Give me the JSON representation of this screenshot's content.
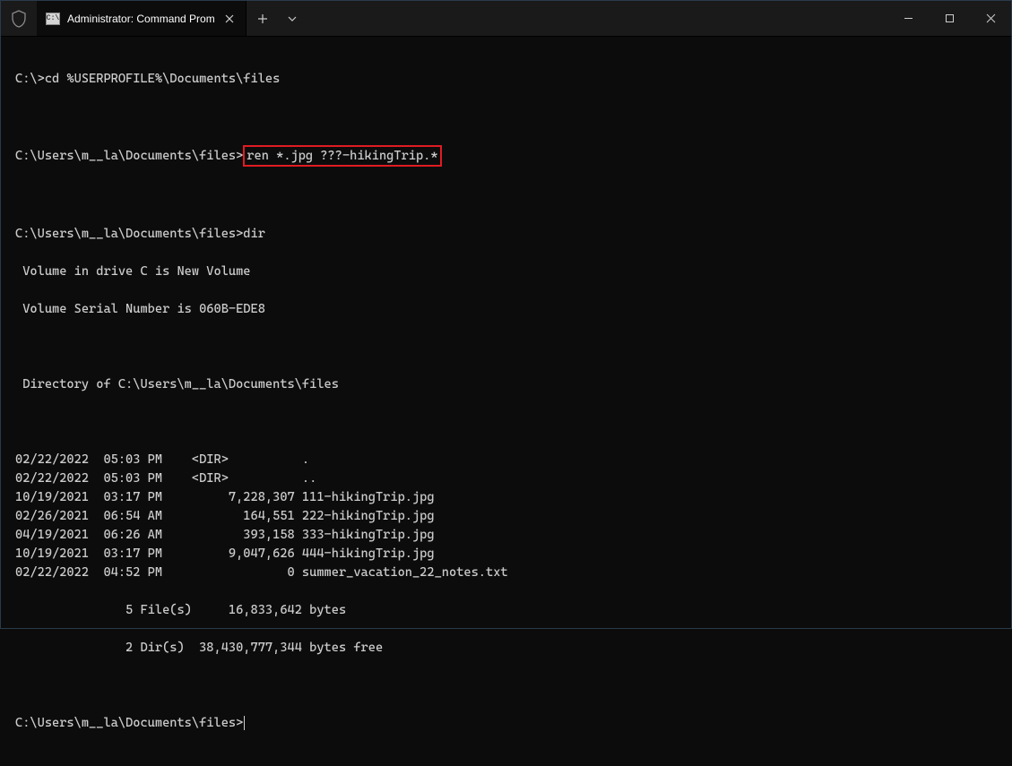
{
  "window": {
    "tab_title": "Administrator: Command Prom"
  },
  "terminal": {
    "line1_prompt": "C:\\>",
    "line1_cmd": "cd %USERPROFILE%\\Documents\\files",
    "line2_prompt": "C:\\Users\\m__la\\Documents\\files>",
    "line2_cmd": "ren *.jpg ???-hikingTrip.*",
    "line3_prompt": "C:\\Users\\m__la\\Documents\\files>",
    "line3_cmd": "dir",
    "vol_line": " Volume in drive C is New Volume",
    "serial_line": " Volume Serial Number is 060B-EDE8",
    "dir_of": " Directory of C:\\Users\\m__la\\Documents\\files",
    "rows": [
      "02/22/2022  05:03 PM    <DIR>          .",
      "02/22/2022  05:03 PM    <DIR>          ..",
      "10/19/2021  03:17 PM         7,228,307 111-hikingTrip.jpg",
      "02/26/2021  06:54 AM           164,551 222-hikingTrip.jpg",
      "04/19/2021  06:26 AM           393,158 333-hikingTrip.jpg",
      "10/19/2021  03:17 PM         9,047,626 444-hikingTrip.jpg",
      "02/22/2022  04:52 PM                 0 summer_vacation_22_notes.txt"
    ],
    "summary1": "               5 File(s)     16,833,642 bytes",
    "summary2": "               2 Dir(s)  38,430,777,344 bytes free",
    "line4_prompt": "C:\\Users\\m__la\\Documents\\files>"
  }
}
